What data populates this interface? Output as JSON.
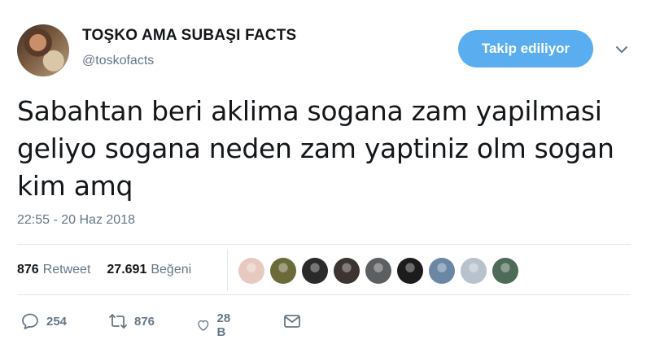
{
  "tweet": {
    "display_name": "TOŞKO AMA SUBAŞI FACTS",
    "handle": "@toskofacts",
    "follow_label": "Takip ediliyor",
    "text": "Sabahtan beri aklima sogana zam yapilmasi\ngeliyo sogana neden zam yaptiniz olm sogan\nkim amq",
    "timestamp": "22:55 - 20 Haz 2018"
  },
  "stats": {
    "retweets_count": "876",
    "retweets_label": "Retweet",
    "likes_count": "27.691",
    "likes_label": "Beğeni"
  },
  "likers": [
    {
      "name": "liker-avatar-1",
      "color": "#e8c9c0"
    },
    {
      "name": "liker-avatar-2",
      "color": "#6b6a3a"
    },
    {
      "name": "liker-avatar-3",
      "color": "#2a2a2a"
    },
    {
      "name": "liker-avatar-4",
      "color": "#3b3430"
    },
    {
      "name": "liker-avatar-5",
      "color": "#5c5f62"
    },
    {
      "name": "liker-avatar-6",
      "color": "#1c1c1c"
    },
    {
      "name": "liker-avatar-7",
      "color": "#6a87a5"
    },
    {
      "name": "liker-avatar-8",
      "color": "#b8c2cc"
    },
    {
      "name": "liker-avatar-9",
      "color": "#4e6a58"
    }
  ],
  "actions": {
    "reply_count": "254",
    "retweet_count": "876",
    "like_count": "28 B"
  },
  "icons": {
    "reply": "reply-icon",
    "retweet": "retweet-icon",
    "like": "heart-icon",
    "dm": "envelope-icon",
    "more": "chevron-down-icon"
  },
  "colors": {
    "accent": "#5aaef0",
    "secondary_text": "#657786",
    "border": "#e1e8ed"
  }
}
